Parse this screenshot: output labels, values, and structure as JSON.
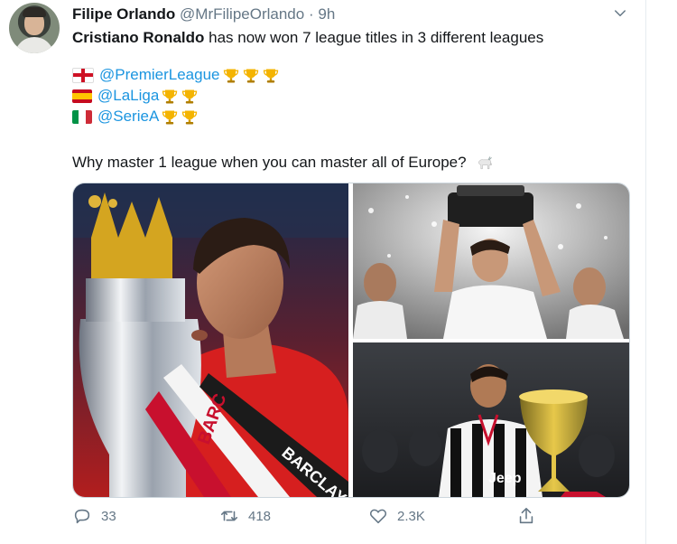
{
  "tweet": {
    "author_name": "Filipe Orlando",
    "author_handle": "@MrFilipeOrlando",
    "separator": "·",
    "time": "9h",
    "text_line1_bold": "Cristiano Ronaldo",
    "text_line1_rest": " has now won 7 league titles in 3 different leagues",
    "leagues": [
      {
        "flag": "england-flag",
        "mention": "@PremierLeague",
        "trophies": 3
      },
      {
        "flag": "spain-flag",
        "mention": "@LaLiga",
        "trophies": 2
      },
      {
        "flag": "italy-flag",
        "mention": "@SerieA",
        "trophies": 2
      }
    ],
    "closing_line": "Why master 1 league when you can master all of Europe?",
    "closing_emoji": "goat-icon"
  },
  "media": {
    "photo_left_banner_text": "BARCLAYS",
    "photo_left_sash_text": "BARC",
    "photo_br_sponsor": "Jeep"
  },
  "actions": {
    "reply_count": "33",
    "retweet_count": "418",
    "like_count": "2.3K"
  },
  "colors": {
    "accent": "#1b95e0",
    "secondary_text": "#657786",
    "primary_text": "#14171a"
  }
}
